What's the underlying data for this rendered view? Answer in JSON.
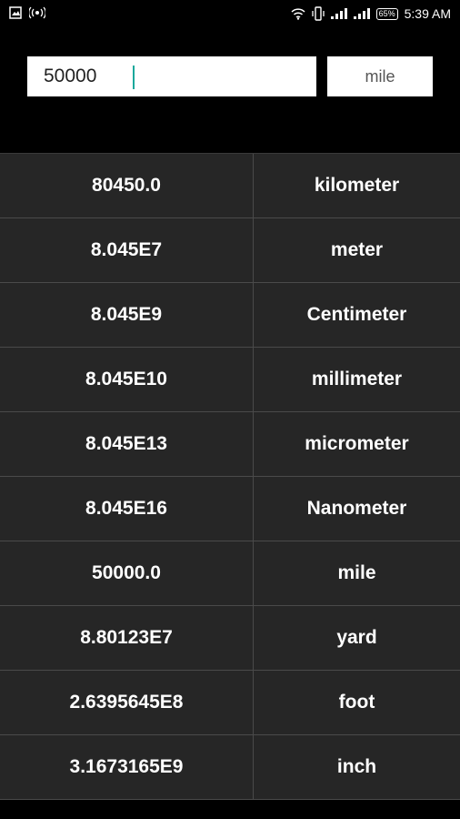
{
  "status_bar": {
    "time": "5:39 AM",
    "battery": "65%",
    "left_icons": [
      "gallery-icon",
      "hotspot-icon"
    ],
    "right_icons": [
      "wifi-icon",
      "vibrate-icon",
      "signal-icon",
      "signal-icon",
      "battery-icon"
    ]
  },
  "converter": {
    "input_value": "50000",
    "unit": "mile"
  },
  "results": [
    {
      "value": "80450.0",
      "unit": "kilometer"
    },
    {
      "value": "8.045E7",
      "unit": "meter"
    },
    {
      "value": "8.045E9",
      "unit": "Centimeter"
    },
    {
      "value": "8.045E10",
      "unit": "millimeter"
    },
    {
      "value": "8.045E13",
      "unit": "micrometer"
    },
    {
      "value": "8.045E16",
      "unit": "Nanometer"
    },
    {
      "value": "50000.0",
      "unit": "mile"
    },
    {
      "value": "8.80123E7",
      "unit": "yard"
    },
    {
      "value": "2.6395645E8",
      "unit": "foot"
    },
    {
      "value": "3.1673165E9",
      "unit": "inch"
    }
  ],
  "colors": {
    "background": "#000000",
    "row_background": "#262626",
    "divider": "#4a4a4a",
    "text": "#ffffff",
    "caret": "#1aa89c"
  }
}
